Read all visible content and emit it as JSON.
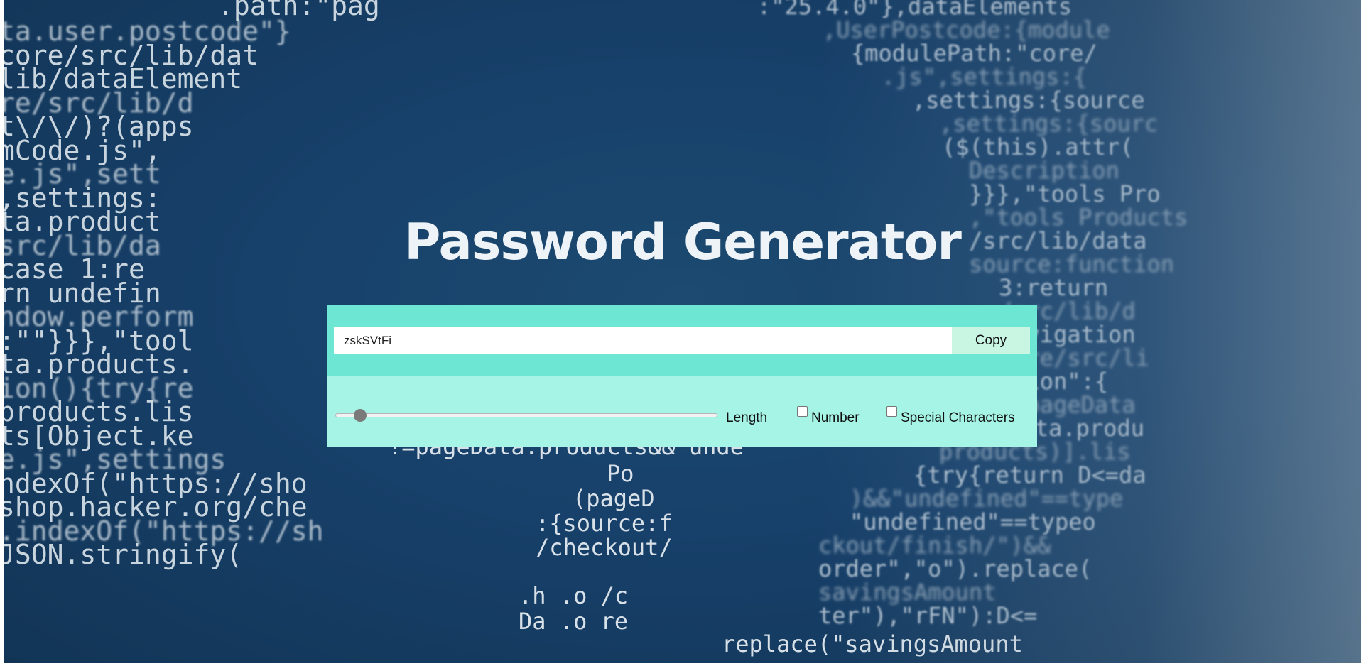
{
  "app": {
    "title": "Password Generator"
  },
  "password": {
    "value": "zskSVtFi"
  },
  "copy_button": {
    "label": "Copy"
  },
  "length": {
    "label": "Length",
    "slider_fraction": 0.05
  },
  "options": {
    "number": {
      "label": "Number",
      "checked": false
    },
    "special": {
      "label": "Special Characters",
      "checked": false
    }
  },
  "colors": {
    "panel_top": "#6de6d4",
    "panel_bottom": "#a6f4e6",
    "copy_button": "#c9f6e2",
    "background": "#17406a"
  },
  "background_code": {
    "left": [
      "ta.user.postcode\"}",
      "core/src/lib/dat",
      "lib/dataElement",
      "re/src/lib/d",
      "t\\/\\/)?(apps",
      "mCode.js\",",
      "e.js\",sett",
      ",settings:",
      "ta.product",
      "src/lib/da",
      "case 1:re",
      "rn undefin",
      "ndow.perform",
      ":\"\"}}},\"tool",
      "ta.products.",
      "ion(){try{re",
      "products.lis",
      "ts[Object.ke",
      "e.js\",settings",
      "ndexOf(\"https://sho",
      "shop.hacker.org/che",
      ".indexOf(\"https://sh",
      "JSON.stringify("
    ],
    "top_left": ".path:\"pag",
    "right": [
      ":\"25.4.0\"},dataElements",
      ",UserPostcode:{module",
      "{modulePath:\"core/",
      ".js\",settings:{",
      ",settings:{source",
      ",settings:{sourc",
      "($(this).attr(",
      "Description",
      "}}},\"tools Pro",
      ",\"tools Products",
      "/src/lib/data",
      "source:function",
      "3:return",
      "/src/lib/d",
      "navigation",
      "core/src/li",
      "ition\":{",
      "f pageData",
      "=pageData.produ",
      "products)].lis",
      "{try{return D<=da",
      ")&&\"undefined\"==type",
      "\"undefined\"==typeo",
      "ckout/finish/\")&&",
      "order\",\"o\").replace(",
      "savingsAmount",
      "ter\"),\"rFN\"):D<="
    ],
    "center": [
      "!=pageData.products&& unde",
      "Po",
      "(pageD",
      ":{source:f",
      "/checkout/",
      ".h      .o      /c",
      "Da      .o      re",
      "replace(\"savingsAmount"
    ]
  }
}
